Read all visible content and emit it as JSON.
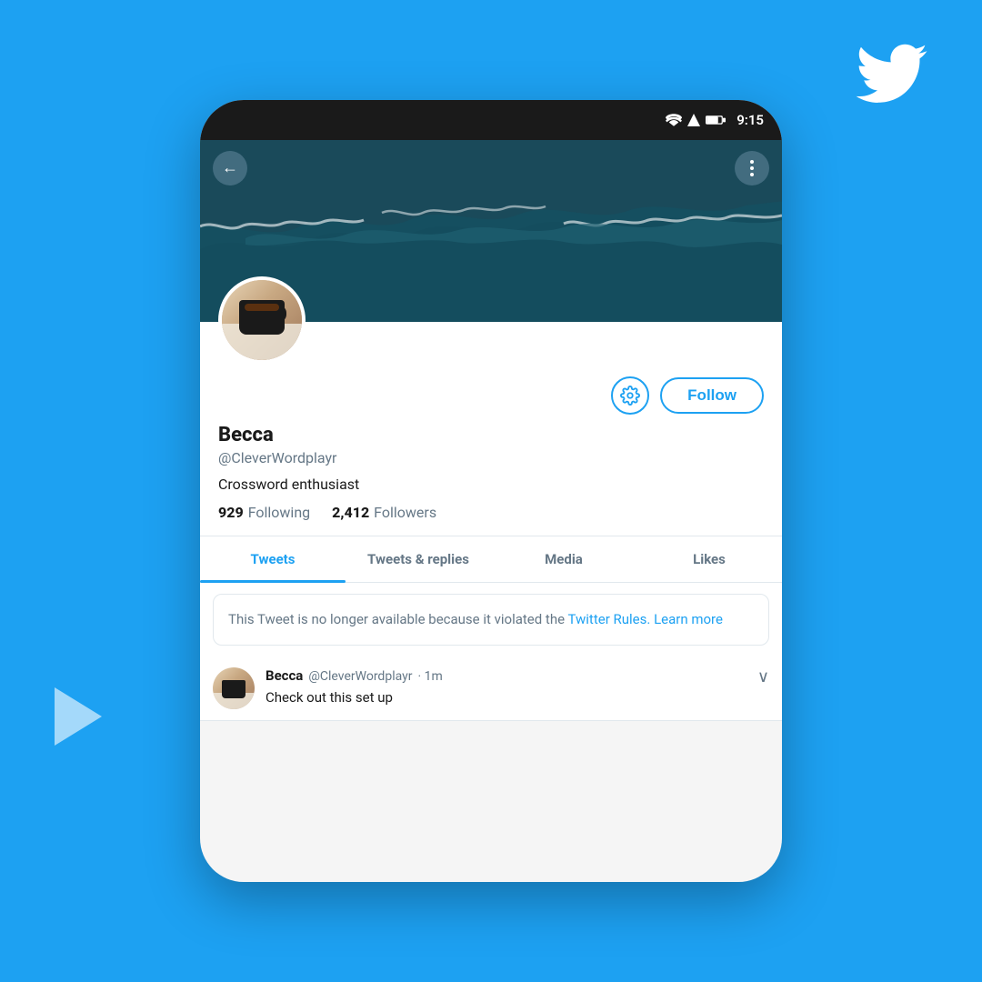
{
  "background_color": "#1da1f2",
  "twitter_logo": "twitter-bird",
  "phone": {
    "status_bar": {
      "time": "9:15"
    },
    "header": {
      "back_button_label": "←",
      "more_button_label": "⋮"
    },
    "profile": {
      "display_name": "Becca",
      "username": "@CleverWordplayr",
      "bio": "Crossword enthusiast",
      "following_count": "929",
      "following_label": "Following",
      "followers_count": "2,412",
      "followers_label": "Followers",
      "gear_button_label": "⚙",
      "follow_button_label": "Follow"
    },
    "tabs": [
      {
        "label": "Tweets",
        "active": true
      },
      {
        "label": "Tweets & replies",
        "active": false
      },
      {
        "label": "Media",
        "active": false
      },
      {
        "label": "Likes",
        "active": false
      }
    ],
    "tweet_notice": {
      "text": "This Tweet is no longer available because it violated the ",
      "link1": "Twitter Rules.",
      "separator": " ",
      "link2": "Learn more"
    },
    "tweet_item": {
      "name": "Becca",
      "handle": "@CleverWordplayr",
      "time": "· 1m",
      "text": "Check out this set up"
    }
  }
}
